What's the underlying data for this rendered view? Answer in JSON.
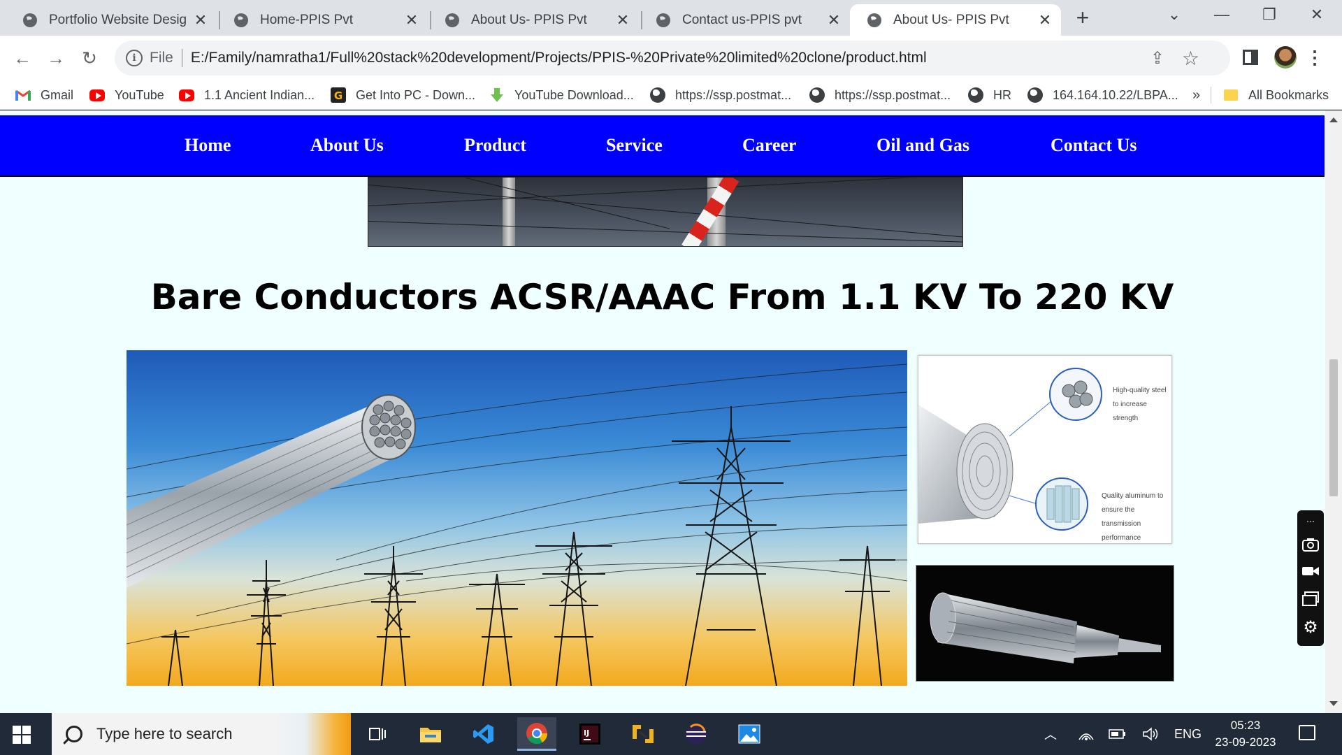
{
  "browser": {
    "tabs": [
      {
        "title": "Portfolio Website Design-",
        "active": false
      },
      {
        "title": "Home-PPIS Pvt",
        "active": false
      },
      {
        "title": "About Us- PPIS Pvt",
        "active": false
      },
      {
        "title": "Contact us-PPIS pvt",
        "active": false
      },
      {
        "title": "About Us- PPIS Pvt",
        "active": true
      }
    ],
    "address": {
      "scheme": "File",
      "url": "E:/Family/namratha1/Full%20stack%20development/Projects/PPIS-%20Private%20limited%20clone/product.html"
    },
    "bookmarks": [
      {
        "label": "Gmail",
        "icon": "gmail-icon"
      },
      {
        "label": "YouTube",
        "icon": "youtube-icon"
      },
      {
        "label": "1.1 Ancient Indian...",
        "icon": "youtube-icon"
      },
      {
        "label": "Get Into PC - Down...",
        "icon": "getintopc-icon"
      },
      {
        "label": "YouTube Download...",
        "icon": "download-arrow-icon"
      },
      {
        "label": "https://ssp.postmat...",
        "icon": "globe-icon"
      },
      {
        "label": "https://ssp.postmat...",
        "icon": "globe-icon"
      },
      {
        "label": "HR",
        "icon": "globe-icon"
      },
      {
        "label": "164.164.10.22/LBPA...",
        "icon": "globe-icon"
      }
    ],
    "bookmarks_overflow": "»",
    "all_bookmarks": "All Bookmarks"
  },
  "page": {
    "nav": [
      "Home",
      "About Us",
      "Product",
      "Service",
      "Career",
      "Oil and Gas",
      "Contact Us"
    ],
    "product_title": "Bare Conductors ACSR/AAAC From 1.1 KV To 220 KV",
    "diagram_captions": {
      "steel": [
        "High-quality steel",
        "to increase strength"
      ],
      "aluminum": [
        "Quality aluminum to",
        "ensure the transmission",
        "performance"
      ]
    },
    "nav_color": "#0000ff",
    "background_color": "#f0ffff"
  },
  "taskbar": {
    "search_placeholder": "Type here to search",
    "language": "ENG",
    "time": "05:23",
    "date": "23-09-2023"
  }
}
